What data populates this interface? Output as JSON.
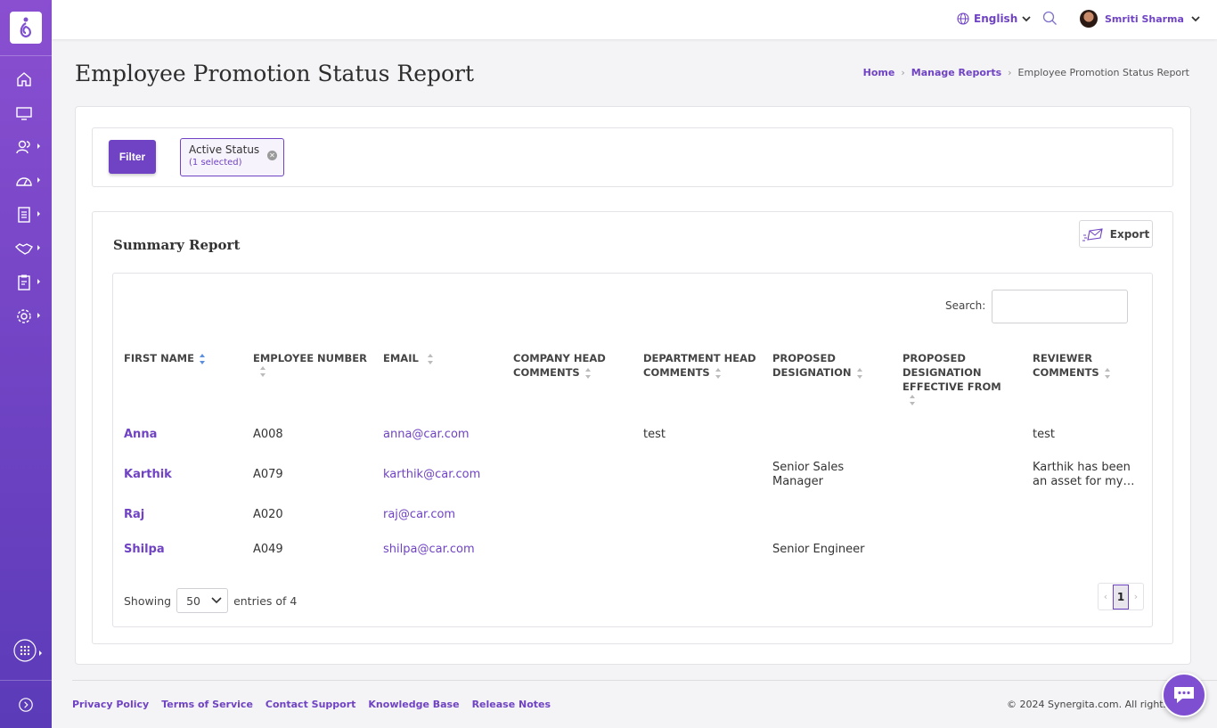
{
  "app": {
    "brand_color": "#6f43c3"
  },
  "topbar": {
    "language": "English",
    "user_name": "Smriti Sharma"
  },
  "page": {
    "title": "Employee Promotion Status Report"
  },
  "breadcrumb": {
    "home": "Home",
    "manage_reports": "Manage Reports",
    "current": "Employee Promotion Status Report"
  },
  "filter": {
    "button_label": "Filter",
    "chip_title": "Active Status",
    "chip_sub": "(1 selected)"
  },
  "summary": {
    "title": "Summary Report",
    "export_label": "Export",
    "search_label": "Search:"
  },
  "table": {
    "headers": {
      "first_name": "FIRST NAME",
      "employee_number": "EMPLOYEE NUMBER",
      "email": "EMAIL",
      "company_head_1": "COMPANY HEAD",
      "company_head_2": "COMMENTS",
      "dept_head_1": "DEPARTMENT HEAD",
      "dept_head_2": "COMMENTS",
      "proposed_desig_1": "PROPOSED",
      "proposed_desig_2": "DESIGNATION",
      "proposed_eff_1": "PROPOSED",
      "proposed_eff_2": "DESIGNATION",
      "proposed_eff_3": "EFFECTIVE FROM",
      "reviewer_1": "REVIEWER",
      "reviewer_2": "COMMENTS"
    },
    "rows": [
      {
        "first_name": "Anna",
        "employee_number": "A008",
        "email": "anna@car.com",
        "dept_head_comments": "test",
        "reviewer_comments": "test"
      },
      {
        "first_name": "Karthik",
        "employee_number": "A079",
        "email": "karthik@car.com",
        "proposed_designation_1": "Senior Sales",
        "proposed_designation_2": "Manager",
        "reviewer_comments_1": "Karthik has been",
        "reviewer_comments_2": "an asset for my…"
      },
      {
        "first_name": "Raj",
        "employee_number": "A020",
        "email": "raj@car.com"
      },
      {
        "first_name": "Shilpa",
        "employee_number": "A049",
        "email": "shilpa@car.com",
        "proposed_designation": "Senior Engineer"
      }
    ],
    "showing_label": "Showing",
    "page_length": "50",
    "entries_label": "entries of 4",
    "current_page": "1",
    "prev": "‹",
    "next": "›"
  },
  "footer": {
    "links": [
      "Privacy Policy",
      "Terms of Service",
      "Contact Support",
      "Knowledge Base",
      "Release Notes"
    ],
    "copyright": "© 2024 Synergita.com. All rights res"
  }
}
